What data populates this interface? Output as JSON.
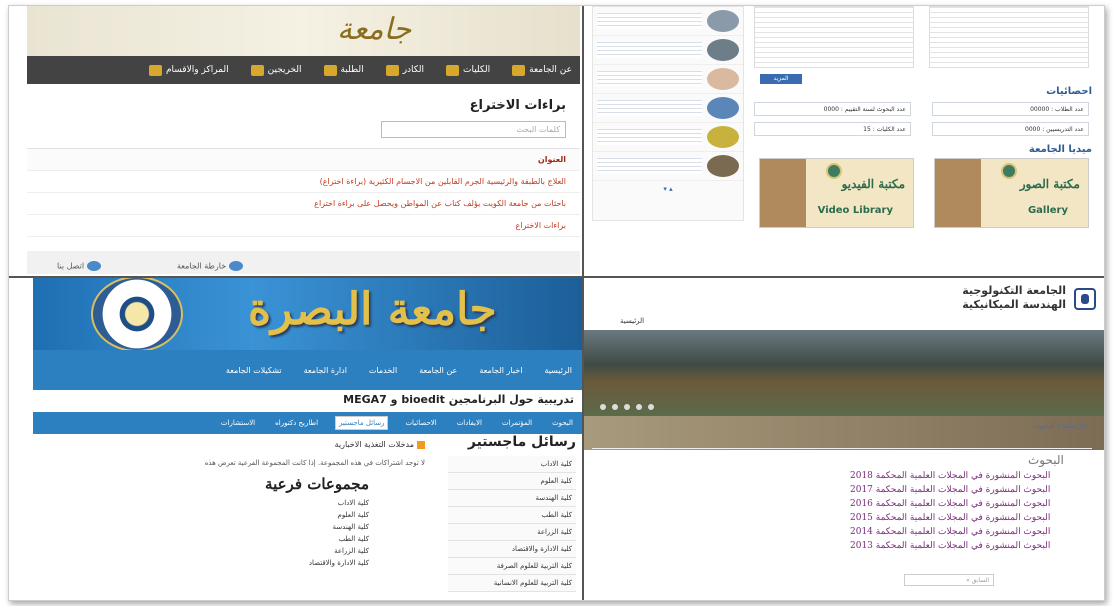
{
  "top_left": {
    "nav": [
      "عن الجامعة",
      "الكليات",
      "الكادر",
      "الطلبة",
      "الخريجين",
      "المراكز والاقسام"
    ],
    "page_title": "براءات الاختراع",
    "search_placeholder": "كلمات البحث",
    "list_header": "العنوان",
    "items": [
      "العلاج بالطبقة والرئيسية الجرم القابلين من الاجسام الكثيرية (براءة اختراع)",
      "باحثات من جامعة الكويت يؤلف كتاب عن المواطن ويحصل على براءة اختراع",
      "براءات الاختراع"
    ],
    "footer_left": "اتصل بنا",
    "footer_right": "خارطة الجامعة"
  },
  "top_right": {
    "stats_title": "احصائيات",
    "stats": [
      "عدد الطلاب : 00000",
      "عدد البحوث لسنة التقييم : 0000",
      "عدد التدريسيين : 0000",
      "عدد الكليات : 15"
    ],
    "media_title": "ميديا الجامعة",
    "media": [
      {
        "ar": "مكتبة الصور",
        "en": "Gallery"
      },
      {
        "ar": "مكتبة الفيديو",
        "en": "Video Library"
      }
    ],
    "more_button": "المزيد"
  },
  "bottom_left": {
    "site_title": "جامعة البصرة",
    "nav": [
      "الرئيسية",
      "اخبار الجامعة",
      "عن الجامعة",
      "الخدمات",
      "ادارة الجامعة",
      "تشكيلات الجامعة"
    ],
    "ticker": "MEGA7 و bioedit تدريبية حول البرنامجين",
    "tabs": [
      "البحوث",
      "المؤتمرات",
      "الايفادات",
      "الاحصائيات",
      "رسائل ماجستير",
      "اطاريح دكتوراه",
      "الاستشارات"
    ],
    "active_tab": "رسائل ماجستير",
    "right_heading": "رسائل ماجستير",
    "right_items": [
      "كلية الاداب",
      "كلية العلوم",
      "كلية الهندسة",
      "كلية الطب",
      "كلية الزراعة",
      "كلية الادارة والاقتصاد",
      "كلية التربية للعلوم الصرفة",
      "كلية التربية للعلوم الانسانية"
    ],
    "rss_label": "مدخلات التغذية الاخبارية",
    "note": "لا توجد اشتراكات في هذه المجموعة. إذا كانت المجموعة الفرعية تعرض هذه",
    "sub_heading": "مجموعات فرعية",
    "sub_items": [
      "كلية الاداب",
      "كلية العلوم",
      "كلية الهندسة",
      "كلية الطب",
      "كلية الزراعة",
      "كلية الادارة والاقتصاد"
    ]
  },
  "bottom_right": {
    "title_line1": "الجامعة التكنولوجية",
    "title_line2": "الهندسة الميكانيكية",
    "nav_home": "الرئيسية",
    "breadcrumb": "الرئيسية › البحوث",
    "section_title": "البحوث",
    "items": [
      "البحوث المنشورة في المجلات العلمية المحكمة 2018",
      "البحوث المنشورة في المجلات العلمية المحكمة 2017",
      "البحوث المنشورة في المجلات العلمية المحكمة 2016",
      "البحوث المنشورة في المجلات العلمية المحكمة 2015",
      "البحوث المنشورة في المجلات العلمية المحكمة 2014",
      "البحوث المنشورة في المجلات العلمية المحكمة 2013"
    ],
    "pager": "« السابق"
  }
}
